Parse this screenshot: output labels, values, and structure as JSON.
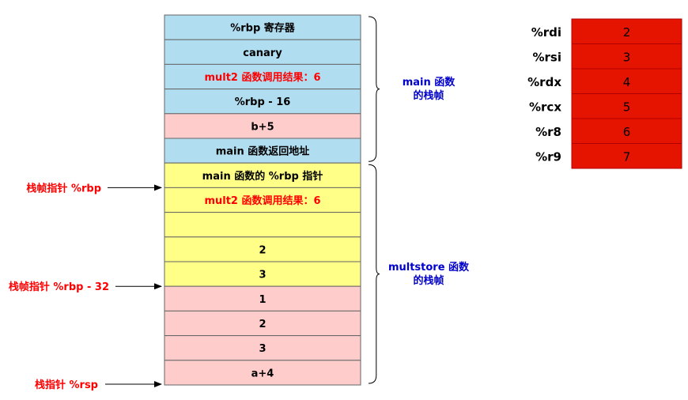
{
  "colors": {
    "blue": "#b1ddf0",
    "yellow": "#ffff88",
    "pink": "#ffcccc",
    "red_cell": "#e51400",
    "red_text": "#ff0000",
    "blue_text": "#0000cc",
    "black": "#000000"
  },
  "stack": [
    {
      "label": "%rbp 寄存器",
      "fill": "blue",
      "text_color": "black"
    },
    {
      "label": "canary",
      "fill": "blue",
      "text_color": "black"
    },
    {
      "label": "mult2 函数调用结果：6",
      "fill": "blue",
      "text_color": "red"
    },
    {
      "label": "%rbp - 16",
      "fill": "blue",
      "text_color": "black"
    },
    {
      "label": "b+5",
      "fill": "pink",
      "text_color": "black"
    },
    {
      "label": "main 函数返回地址",
      "fill": "blue",
      "text_color": "black"
    },
    {
      "label": "main 函数的 %rbp 指针",
      "fill": "yellow",
      "text_color": "black"
    },
    {
      "label": "mult2 函数调用结果：6",
      "fill": "yellow",
      "text_color": "red"
    },
    {
      "label": "",
      "fill": "yellow",
      "text_color": "black"
    },
    {
      "label": "2",
      "fill": "yellow",
      "text_color": "black"
    },
    {
      "label": "3",
      "fill": "yellow",
      "text_color": "black"
    },
    {
      "label": "1",
      "fill": "pink",
      "text_color": "black"
    },
    {
      "label": "2",
      "fill": "pink",
      "text_color": "black"
    },
    {
      "label": "3",
      "fill": "pink",
      "text_color": "black"
    },
    {
      "label": "a+4",
      "fill": "pink",
      "text_color": "black"
    }
  ],
  "frames": [
    {
      "lines": [
        "main 函数",
        "的栈帧"
      ],
      "first_row": 0,
      "last_row": 5
    },
    {
      "lines": [
        "multstore 函数",
        "的栈帧"
      ],
      "first_row": 6,
      "last_row": 14
    }
  ],
  "pointers": [
    {
      "label": "栈帧指针 %rbp",
      "row_boundary": 7
    },
    {
      "label": "栈帧指针 %rbp - 32",
      "row_boundary": 11
    },
    {
      "label": "栈指针 %rsp",
      "row_boundary": 15
    }
  ],
  "registers": [
    {
      "name": "%rdi",
      "value": "2"
    },
    {
      "name": "%rsi",
      "value": "3"
    },
    {
      "name": "%rdx",
      "value": "4"
    },
    {
      "name": "%rcx",
      "value": "5"
    },
    {
      "name": "%r8",
      "value": "6"
    },
    {
      "name": "%r9",
      "value": "7"
    }
  ]
}
